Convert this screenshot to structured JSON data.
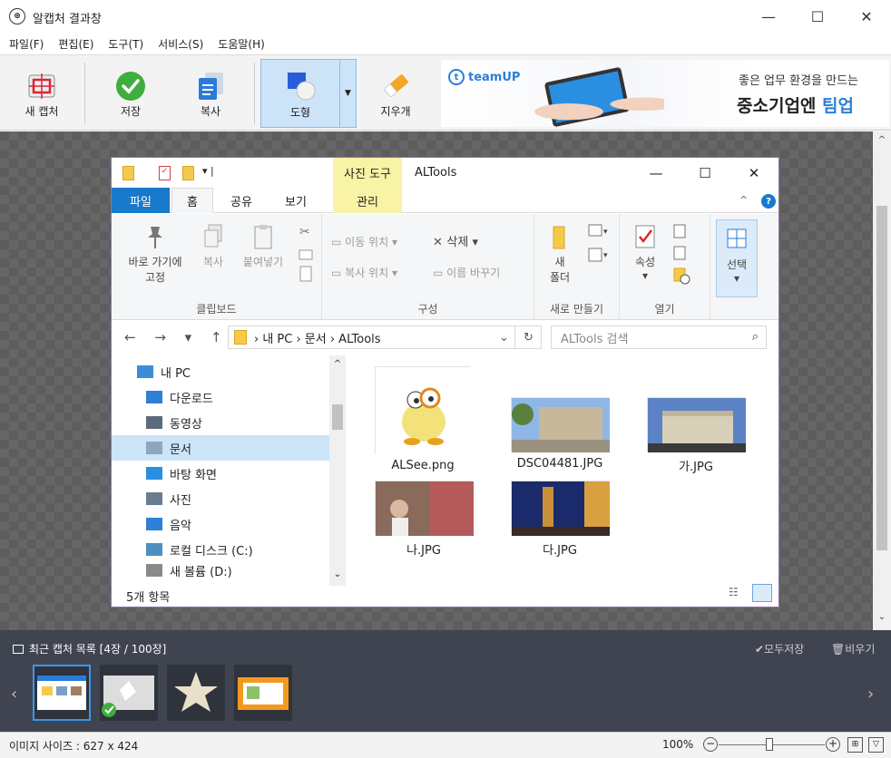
{
  "window": {
    "title": "알캡처 결과창",
    "app_icon_glyph": "⊕",
    "controls": {
      "minimize": "—",
      "maximize": "☐",
      "close": "✕"
    }
  },
  "menu": [
    "파일(F)",
    "편집(E)",
    "도구(T)",
    "서비스(S)",
    "도움말(H)"
  ],
  "toolbar": {
    "new_capture": "새 캡처",
    "save": "저장",
    "copy": "복사",
    "shape": "도형",
    "eraser": "지우개",
    "shape_dropdown": "▼"
  },
  "ad": {
    "brand": "teamUP",
    "line1": "좋은 업무 환경을 만드는",
    "line2_prefix": "중소기업엔 ",
    "line2_accent": "팀업"
  },
  "explorer": {
    "context_tab": "사진 도구",
    "window_title": "ALTools",
    "qa_dropdown": "▾ |",
    "controls": {
      "minimize": "—",
      "maximize": "☐",
      "close": "✕"
    },
    "ribbon_tabs": {
      "file": "파일",
      "home": "홈",
      "share": "공유",
      "view": "보기",
      "manage": "관리"
    },
    "help": "?",
    "collapse": "^",
    "ribbon": {
      "clipboard": {
        "label": "클립보드",
        "pin_line1": "바로 가기에",
        "pin_line2": "고정",
        "copy": "복사",
        "paste": "붙여넣기"
      },
      "organize": {
        "label": "구성",
        "move_to": "이동 위치 ▾",
        "copy_to": "복사 위치 ▾",
        "delete": "삭제 ▾",
        "rename": "이름 바꾸기"
      },
      "new": {
        "label": "새로 만들기",
        "new_folder_line1": "새",
        "new_folder_line2": "폴더"
      },
      "open": {
        "label": "열기",
        "properties": "속성",
        "properties_caret": "▾"
      },
      "select": {
        "label": "선택",
        "caret": "▾"
      }
    },
    "address": {
      "nav": "← → ▾ ↑",
      "path": "› 내 PC › 문서 › ALTools",
      "dropdown": "⌄",
      "refresh": "↻",
      "search_placeholder": "ALTools 검색",
      "search_icon": "⌕"
    },
    "nav_items": [
      {
        "label": "내 PC",
        "icon": "computer-icon",
        "color": "#3c8dd9"
      },
      {
        "label": "다운로드",
        "icon": "download-icon",
        "color": "#2f7fd6"
      },
      {
        "label": "동영상",
        "icon": "video-icon",
        "color": "#5b6b7c"
      },
      {
        "label": "문서",
        "icon": "document-icon",
        "color": "#8fa6bf",
        "selected": true
      },
      {
        "label": "바탕 화면",
        "icon": "desktop-icon",
        "color": "#2a8fe0"
      },
      {
        "label": "사진",
        "icon": "pictures-icon",
        "color": "#6a7c8f"
      },
      {
        "label": "음악",
        "icon": "music-icon",
        "color": "#2f7fd6"
      },
      {
        "label": "로컬 디스크 (C:)",
        "icon": "drive-icon",
        "color": "#4f8fbf"
      },
      {
        "label": "새 볼륨 (D:)",
        "icon": "drive-icon",
        "color": "#8a8a8a"
      }
    ],
    "nav_scroll": {
      "up": "^",
      "down": "⌄"
    },
    "files": [
      {
        "name": "ALSee.png",
        "kind": "alsee"
      },
      {
        "name": "DSC04481.JPG",
        "kind": "photo1"
      },
      {
        "name": "가.JPG",
        "kind": "photo2"
      },
      {
        "name": "나.JPG",
        "kind": "photo3"
      },
      {
        "name": "다.JPG",
        "kind": "photo4"
      }
    ],
    "status": "5개 항목",
    "details_view_glyph": "☷"
  },
  "recent": {
    "title": "최근 캡처 목록 [4장 / 100장]",
    "save_all": "✔모두저장",
    "clear_all": "🗑비우기",
    "prev": "‹",
    "next": "›"
  },
  "statusbar": {
    "image_size": "이미지 사이즈 : 627 x 424",
    "zoom": "100%",
    "zoom_minus": "−",
    "zoom_plus": "+",
    "fit": "⊞",
    "dropdown": "▽"
  },
  "canvas_scroll": {
    "up": "^",
    "down": "⌄"
  }
}
